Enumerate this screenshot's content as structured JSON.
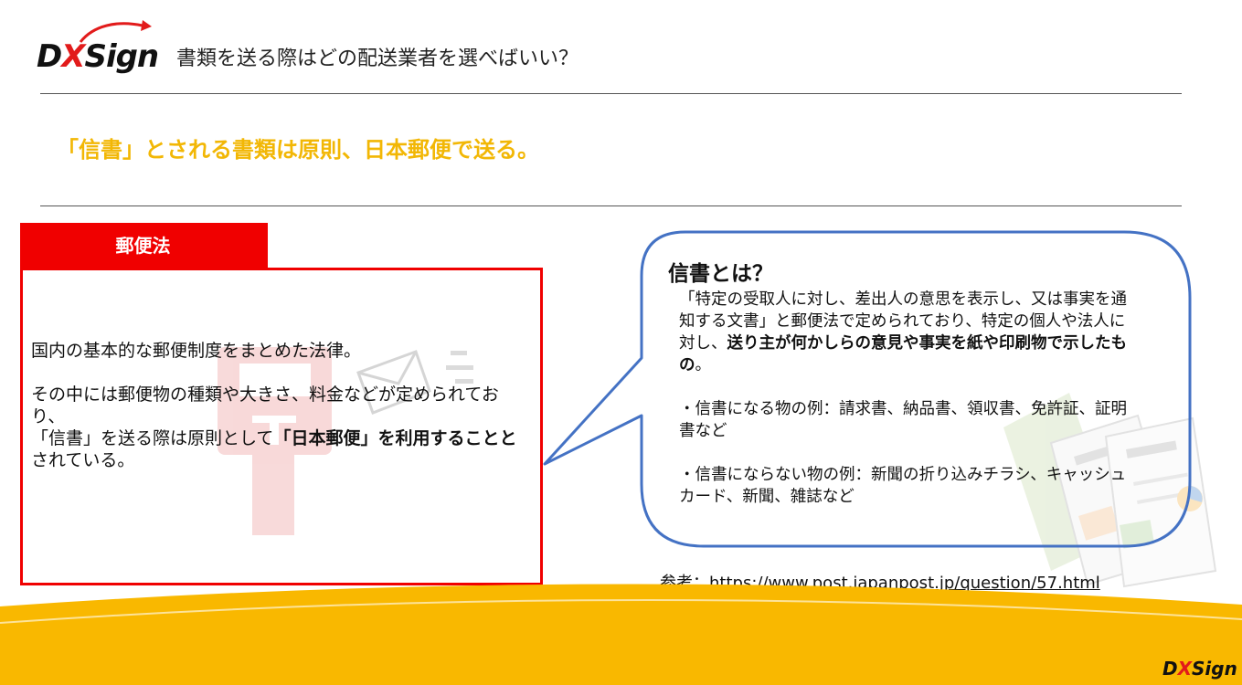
{
  "header": {
    "logo": {
      "pre": "D",
      "x": "X",
      "post": "Sign"
    },
    "title": "書類を送る際はどの配送業者を選べばいい？"
  },
  "headline": "「信書」とされる書類は原則、日本郵便で送る。",
  "law_panel": {
    "tab_label": "郵便法",
    "line1": "国内の基本的な郵便制度をまとめた法律。",
    "line2": "その中には郵便物の種類や大きさ、料金などが定められており、",
    "line3_pre": "「信書」を送る際は原則として",
    "line3_bold": "「日本郵便」を利用することと",
    "line3_post": "されている。"
  },
  "bubble": {
    "title": "信書とは？",
    "def_plain": "「特定の受取人に対し、差出人の意思を表示し、又は事実を通知する文書」と郵便法で定められており、特定の個人や法人に対し、",
    "def_bold": "送り主が何かしらの意見や事実を紙や印刷物で示したもの",
    "def_end": "。",
    "examples_yes": "・信書になる物の例：請求書、納品書、領収書、免許証、証明書など",
    "examples_no": "・信書にならない物の例：新聞の折り込みチラシ、キャッシュカード、新聞、雑誌など"
  },
  "reference": {
    "label": "参考：",
    "url": "https://www.post.japanpost.jp/question/57.html"
  },
  "footer": {
    "logo": {
      "pre": "D",
      "x": "X",
      "post": "Sign"
    }
  },
  "colors": {
    "accent_red": "#f00000",
    "headline_yellow": "#f2b705",
    "bubble_blue": "#4472c4",
    "footer_yellow": "#f9b800"
  },
  "icons": {
    "logo_arrow": "red-curved-arrow-icon",
    "postbox": "postbox-icon",
    "envelope": "envelope-icon",
    "documents": "documents-icon"
  }
}
